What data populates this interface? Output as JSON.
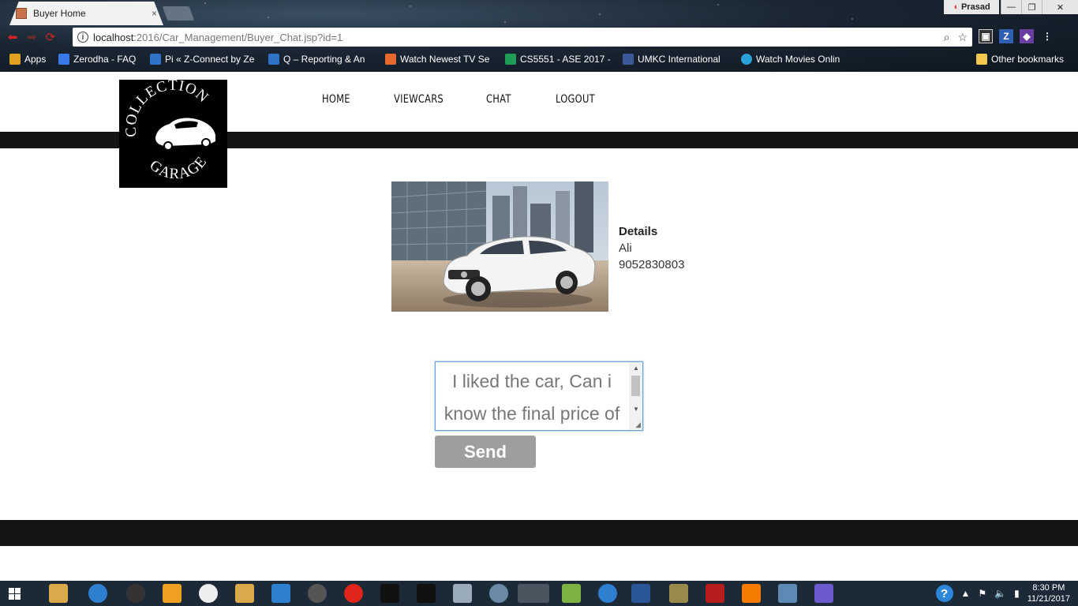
{
  "browser": {
    "tab": {
      "title": "Buyer Home",
      "close": "×"
    },
    "profile": "Prasad",
    "url": {
      "host": "localhost",
      "path": ":2016/Car_Management/Buyer_Chat.jsp?id=1"
    },
    "bookmarks": [
      {
        "label": "Apps",
        "color": "#e0a020"
      },
      {
        "label": "Zerodha - FAQ",
        "color": "#3b78e7"
      },
      {
        "label": "Pi « Z-Connect by Ze",
        "color": "#2f73c9"
      },
      {
        "label": "Q – Reporting & An",
        "color": "#2f73c9"
      },
      {
        "label": "Watch Newest TV Se",
        "color": "#e6682a"
      },
      {
        "label": "CS5551 - ASE 2017 -",
        "color": "#1f9d55"
      },
      {
        "label": "UMKC International",
        "color": "#3b5998"
      },
      {
        "label": "Watch Movies Onlin",
        "color": "#2aa1d8"
      },
      {
        "label": "Other bookmarks",
        "color": "#f2c94c"
      }
    ],
    "extensions": [
      "Z"
    ]
  },
  "site": {
    "logo": {
      "top_text": "COLLECTION",
      "bottom_text": "GARAGE"
    },
    "nav": {
      "home": "HOME",
      "viewcars": "VIEWCARS",
      "chat": "CHAT",
      "logout": "LOGOUT"
    }
  },
  "car": {
    "details_title": "Details",
    "seller_name": "Ali",
    "seller_phone": "9052830803"
  },
  "chat": {
    "message": "I liked the car, Can i know the final price of",
    "send_label": "Send"
  },
  "taskbar": {
    "time": "8:30 PM",
    "date": "11/21/2017"
  }
}
